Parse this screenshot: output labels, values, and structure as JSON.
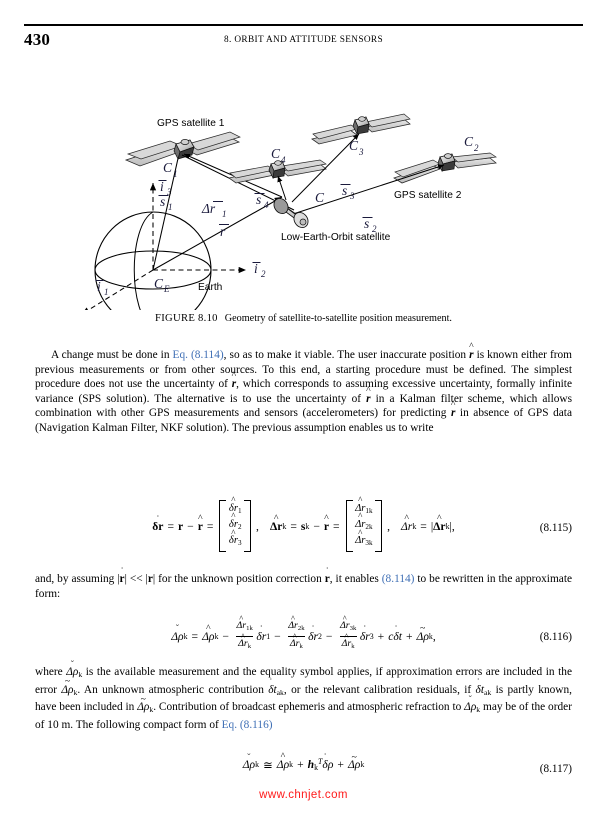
{
  "page": {
    "folio": "430",
    "running_head": "8. ORBIT AND ATTITUDE SENSORS",
    "watermark": "www.chnjet.com"
  },
  "figure": {
    "number": "FIGURE 8.10",
    "caption": "Geometry of satellite-to-satellite position measurement.",
    "labels": {
      "gps1": "GPS satellite 1",
      "gps2": "GPS satellite 2",
      "leo": "Low-Earth-Orbit satellite",
      "earth": "Earth",
      "c1": "C",
      "c1_sub": "1",
      "c2": "C",
      "c2_sub": "2",
      "c3": "C",
      "c3_sub": "3",
      "c4": "C",
      "c4_sub": "4",
      "c": "C",
      "ce": "C",
      "ce_sub": "E",
      "s1": "s",
      "s1_sub": "1",
      "s2": "s",
      "s2_sub": "2",
      "s3": "s",
      "s3_sub": "3",
      "s4": "s",
      "s4_sub": "4",
      "dr1": "Δr",
      "dr1_sub": "1",
      "r": "r",
      "i1": "i",
      "i1_sub": "1",
      "i2": "i",
      "i2_sub": "2",
      "i3": "i",
      "i3_sub": "3"
    }
  },
  "body": {
    "p1": {
      "seg1": "A change must be done in ",
      "eqref1": "Eq. (8.114)",
      "seg2": ", so as to make it viable. The user inaccurate position ",
      "seg3": " is known either from previous measurements or from other sources. To this end, a starting procedure must be defined. The simplest procedure does not use the uncertainty of ",
      "seg4": ", which corresponds to assuming excessive uncertainty, formally infinite variance (SPS solution). The alternative is to use the uncertainty of ",
      "seg5": " in a Kalman filter scheme, which allows combination with other GPS measurements and sensors (accelerometers) for predicting ",
      "seg6": " in absence of GPS data (Navigation Kalman Filter, NKF solution). The previous assumption enables us to write"
    },
    "p2": {
      "seg1": "and, by assuming ",
      "seg2": " for the unknown position correction ",
      "seg3": ", it enables ",
      "eqref1": "(8.114)",
      "seg4": " to be rewritten in the approximate form:"
    },
    "p3": {
      "seg1": "where ",
      "seg2": " is the available measurement and the equality symbol applies, if approximation errors are included in the error ",
      "seg3": ". An unknown atmospheric contribution ",
      "seg4": ", or the relevant calibration residuals, if ",
      "seg5": " is partly known, have been included in ",
      "seg6": ". Contribution of broadcast ephemeris and atmospheric refraction to ",
      "seg7": " may be of the order of 10 m. The following compact form of ",
      "eqref1": "Eq. (8.116)"
    }
  },
  "equations": {
    "eq115": {
      "number": "(8.115)",
      "lhs1_a": "δr",
      "lhs1_b": "r",
      "lhs1_c": "r",
      "vec1": [
        "δr",
        "δr",
        "δr"
      ],
      "vec1_subs": [
        "1",
        "2",
        "3"
      ],
      "lhs2_a": "Δr",
      "lhs2_b": "s",
      "lhs2_b_sub": "k",
      "lhs2_c": "r",
      "vec2": [
        "Δr",
        "Δr",
        "Δr"
      ],
      "vec2_subs": [
        "1k",
        "2k",
        "3k"
      ],
      "lhs3_a": "Δr",
      "lhs3_a_sub": "k",
      "lhs3_b": "Δr",
      "lhs3_b_sub": "k"
    },
    "eq116": {
      "number": "(8.116)",
      "lhs": "Δρ",
      "lhs_sub": "k",
      "t1": "Δρ",
      "t1_sub": "k",
      "f1_num": "Δr",
      "f1_num_sub": "1k",
      "f1_den": "Δr",
      "f1_den_sub": "k",
      "f1_tail": "δr",
      "f1_tail_sub": "1",
      "f2_num": "Δr",
      "f2_num_sub": "2k",
      "f2_den": "Δr",
      "f2_den_sub": "k",
      "f2_tail": "δr",
      "f2_tail_sub": "2",
      "f3_num": "Δr",
      "f3_num_sub": "3k",
      "f3_den": "Δr",
      "f3_den_sub": "k",
      "f3_tail": "δr",
      "f3_tail_sub": "3",
      "t5": "cδt",
      "t6": "Δρ",
      "t6_sub": "k"
    },
    "eq117": {
      "number": "(8.117)",
      "lhs": "Δρ",
      "lhs_sub": "k",
      "t1": "Δρ",
      "t1_sub": "k",
      "t2": "h",
      "t2_sub": "k",
      "t2_sup": "T",
      "t2_tail": "δρ",
      "t3": "Δρ",
      "t3_sub": "k"
    }
  }
}
